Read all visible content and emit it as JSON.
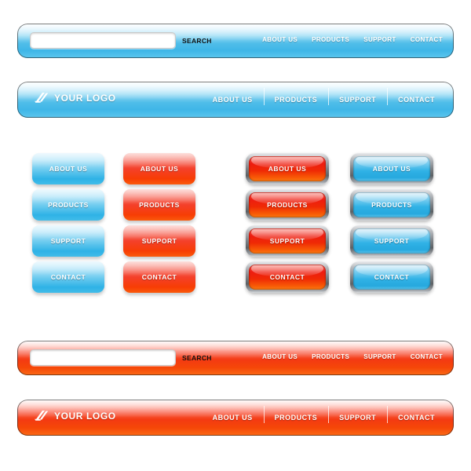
{
  "nav_items": [
    "ABOUT US",
    "PRODUCTS",
    "SUPPORT",
    "CONTACT"
  ],
  "colors": {
    "blue_light": "#d8f2fd",
    "blue_mid": "#4fbde9",
    "red_light": "#fdbdb4",
    "red_mid": "#f43a12",
    "metal_gray": "#7f8489",
    "text_white": "#ffffff",
    "text_dark": "#111111"
  },
  "search_bar_blue": {
    "input_value": "",
    "input_placeholder": "",
    "search_label": "SEARCH",
    "nav": [
      "ABOUT US",
      "PRODUCTS",
      "SUPPORT",
      "CONTACT"
    ]
  },
  "logo_bar_blue": {
    "logo_text": "YOUR LOGO",
    "logo_icon": "swoosh-icon",
    "nav": [
      "ABOUT US",
      "PRODUCTS",
      "SUPPORT",
      "CONTACT"
    ]
  },
  "button_columns": [
    {
      "style": "plain-blue",
      "buttons": [
        "ABOUT US",
        "PRODUCTS",
        "SUPPORT",
        "CONTACT"
      ]
    },
    {
      "style": "plain-red",
      "buttons": [
        "ABOUT US",
        "PRODUCTS",
        "SUPPORT",
        "CONTACT"
      ]
    },
    {
      "style": "metal-red",
      "buttons": [
        "ABOUT US",
        "PRODUCTS",
        "SUPPORT",
        "CONTACT"
      ]
    },
    {
      "style": "metal-blue",
      "buttons": [
        "ABOUT US",
        "PRODUCTS",
        "SUPPORT",
        "CONTACT"
      ]
    }
  ],
  "search_bar_red": {
    "input_value": "",
    "input_placeholder": "",
    "search_label": "SEARCH",
    "nav": [
      "ABOUT US",
      "PRODUCTS",
      "SUPPORT",
      "CONTACT"
    ]
  },
  "logo_bar_red": {
    "logo_text": "YOUR LOGO",
    "logo_icon": "swoosh-icon",
    "nav": [
      "ABOUT US",
      "PRODUCTS",
      "SUPPORT",
      "CONTACT"
    ]
  }
}
